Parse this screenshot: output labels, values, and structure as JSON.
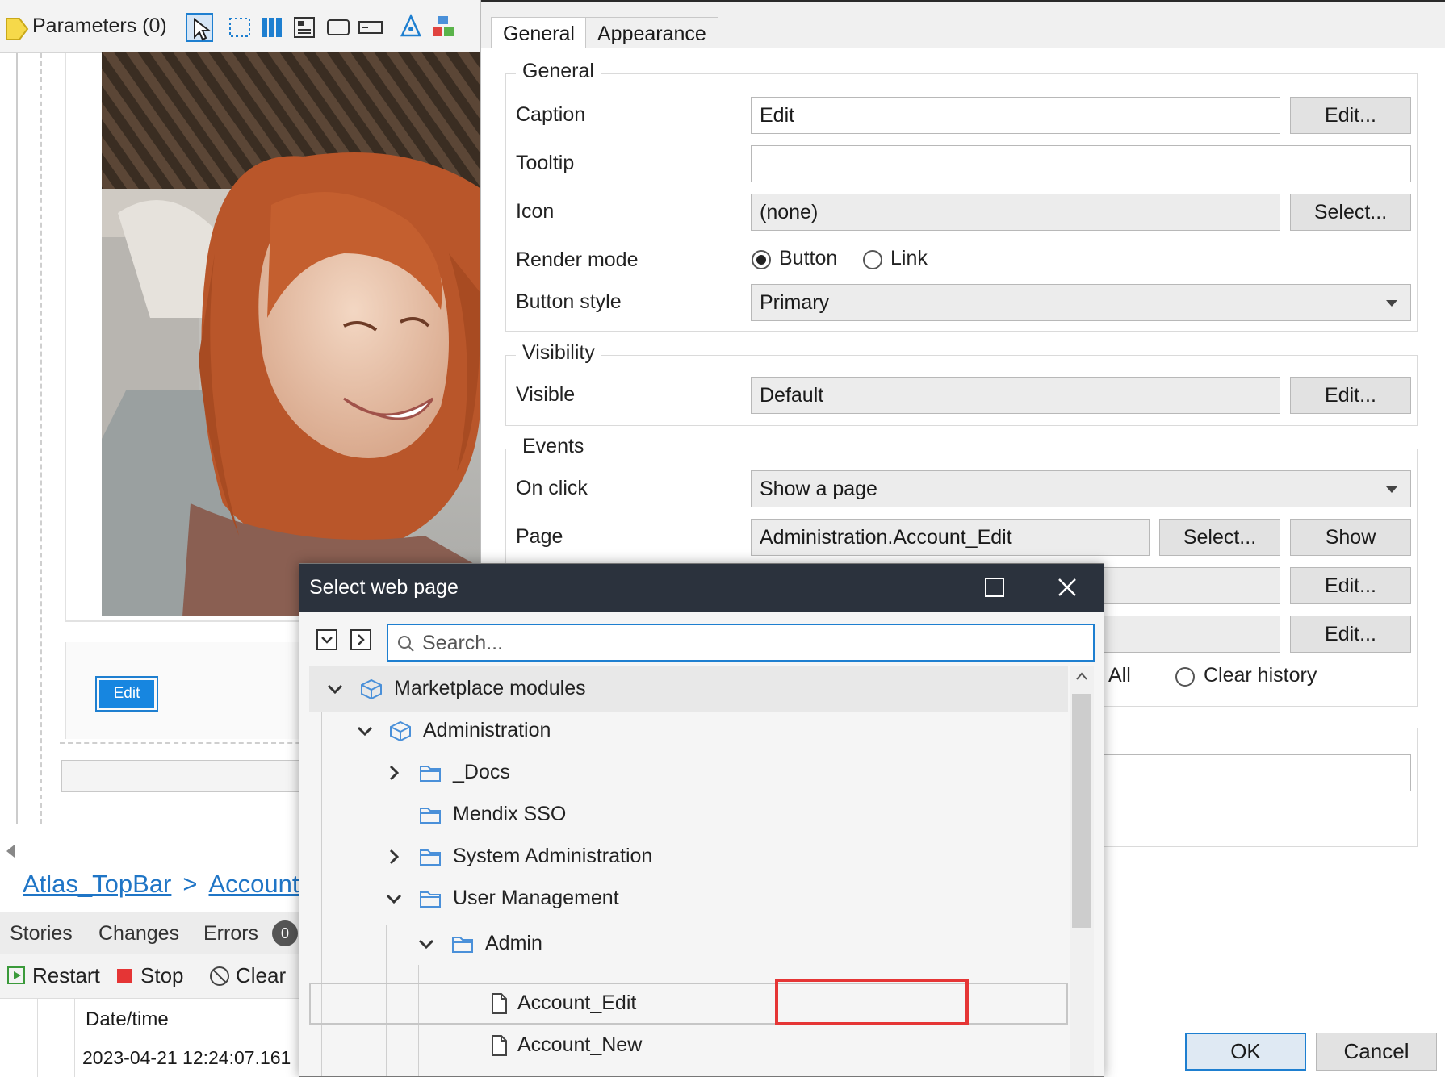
{
  "left": {
    "parameters_label": "Parameters (0)",
    "preview_button_label": "Edit",
    "breadcrumb": [
      "Atlas_TopBar",
      ">",
      "Account_"
    ],
    "bottom_tabs": [
      "Stories",
      "Changes",
      "Errors"
    ],
    "errors_count": "0",
    "run_toolbar": {
      "restart": "Restart",
      "stop": "Stop",
      "clear": "Clear"
    },
    "log_header": "Date/time",
    "log_row_time": "2023-04-21 12:24:07.161"
  },
  "props": {
    "tabs": [
      "General",
      "Appearance"
    ],
    "general_group": {
      "title": "General",
      "caption_label": "Caption",
      "caption_value": "Edit",
      "caption_button": "Edit...",
      "tooltip_label": "Tooltip",
      "tooltip_value": "",
      "icon_label": "Icon",
      "icon_value": "(none)",
      "icon_button": "Select...",
      "render_mode_label": "Render mode",
      "render_options": [
        "Button",
        "Link"
      ],
      "render_selected": "Button",
      "button_style_label": "Button style",
      "button_style_value": "Primary"
    },
    "visibility_group": {
      "title": "Visibility",
      "visible_label": "Visible",
      "visible_value": "Default",
      "visible_button": "Edit..."
    },
    "events_group": {
      "title": "Events",
      "on_click_label": "On click",
      "on_click_value": "Show a page",
      "page_label": "Page",
      "page_value": "Administration.Account_Edit",
      "page_select_button": "Select...",
      "page_show_button": "Show",
      "row3_button": "Edit...",
      "row4_button": "Edit...",
      "close_pages_partial": "All",
      "clear_history_label": "Clear history"
    },
    "ok_label": "OK",
    "cancel_label": "Cancel"
  },
  "select_dialog": {
    "title": "Select web page",
    "search_placeholder": "Search...",
    "tree": [
      {
        "label": "Marketplace modules",
        "type": "module",
        "expanded": true,
        "depth": 0
      },
      {
        "label": "Administration",
        "type": "module",
        "expanded": true,
        "depth": 1
      },
      {
        "label": "_Docs",
        "type": "folder",
        "expanded": false,
        "depth": 2
      },
      {
        "label": "Mendix SSO",
        "type": "folder",
        "depth": 2
      },
      {
        "label": "System Administration",
        "type": "folder",
        "expanded": false,
        "depth": 2
      },
      {
        "label": "User Management",
        "type": "folder",
        "expanded": true,
        "depth": 2
      },
      {
        "label": "Admin",
        "type": "folder",
        "expanded": true,
        "depth": 3
      },
      {
        "label": "Account_Edit",
        "type": "page",
        "selected": true,
        "depth": 4
      },
      {
        "label": "Account_New",
        "type": "page",
        "depth": 4
      }
    ]
  },
  "colors": {
    "accent": "#1e7fd0",
    "highlight_box": "#e53535",
    "dialog_titlebar": "#2b323d"
  }
}
